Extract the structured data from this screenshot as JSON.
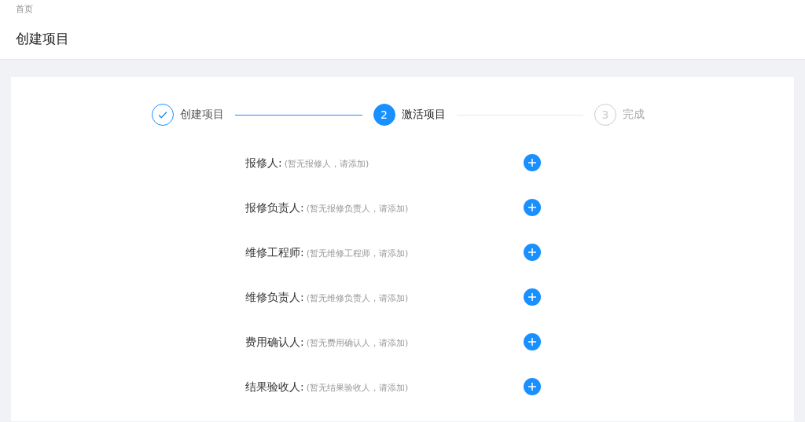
{
  "breadcrumb": "首页",
  "page_title": "创建项目",
  "steps": [
    {
      "label": "创建项目",
      "done": true,
      "selected": false
    },
    {
      "number": "2",
      "label": "激活项目",
      "done": false,
      "selected": true
    },
    {
      "number": "3",
      "label": "完成",
      "done": false,
      "selected": false
    }
  ],
  "roles": [
    {
      "label": "报修人:",
      "hint": "(暂无报修人，请添加)"
    },
    {
      "label": "报修负责人:",
      "hint": "(暂无报修负责人，请添加)"
    },
    {
      "label": "维修工程师:",
      "hint": "(暂无维修工程师，请添加)"
    },
    {
      "label": "维修负责人:",
      "hint": "(暂无维修负责人，请添加)"
    },
    {
      "label": "费用确认人:",
      "hint": "(暂无费用确认人，请添加)"
    },
    {
      "label": "结果验收人:",
      "hint": "(暂无结果验收人，请添加)"
    }
  ]
}
